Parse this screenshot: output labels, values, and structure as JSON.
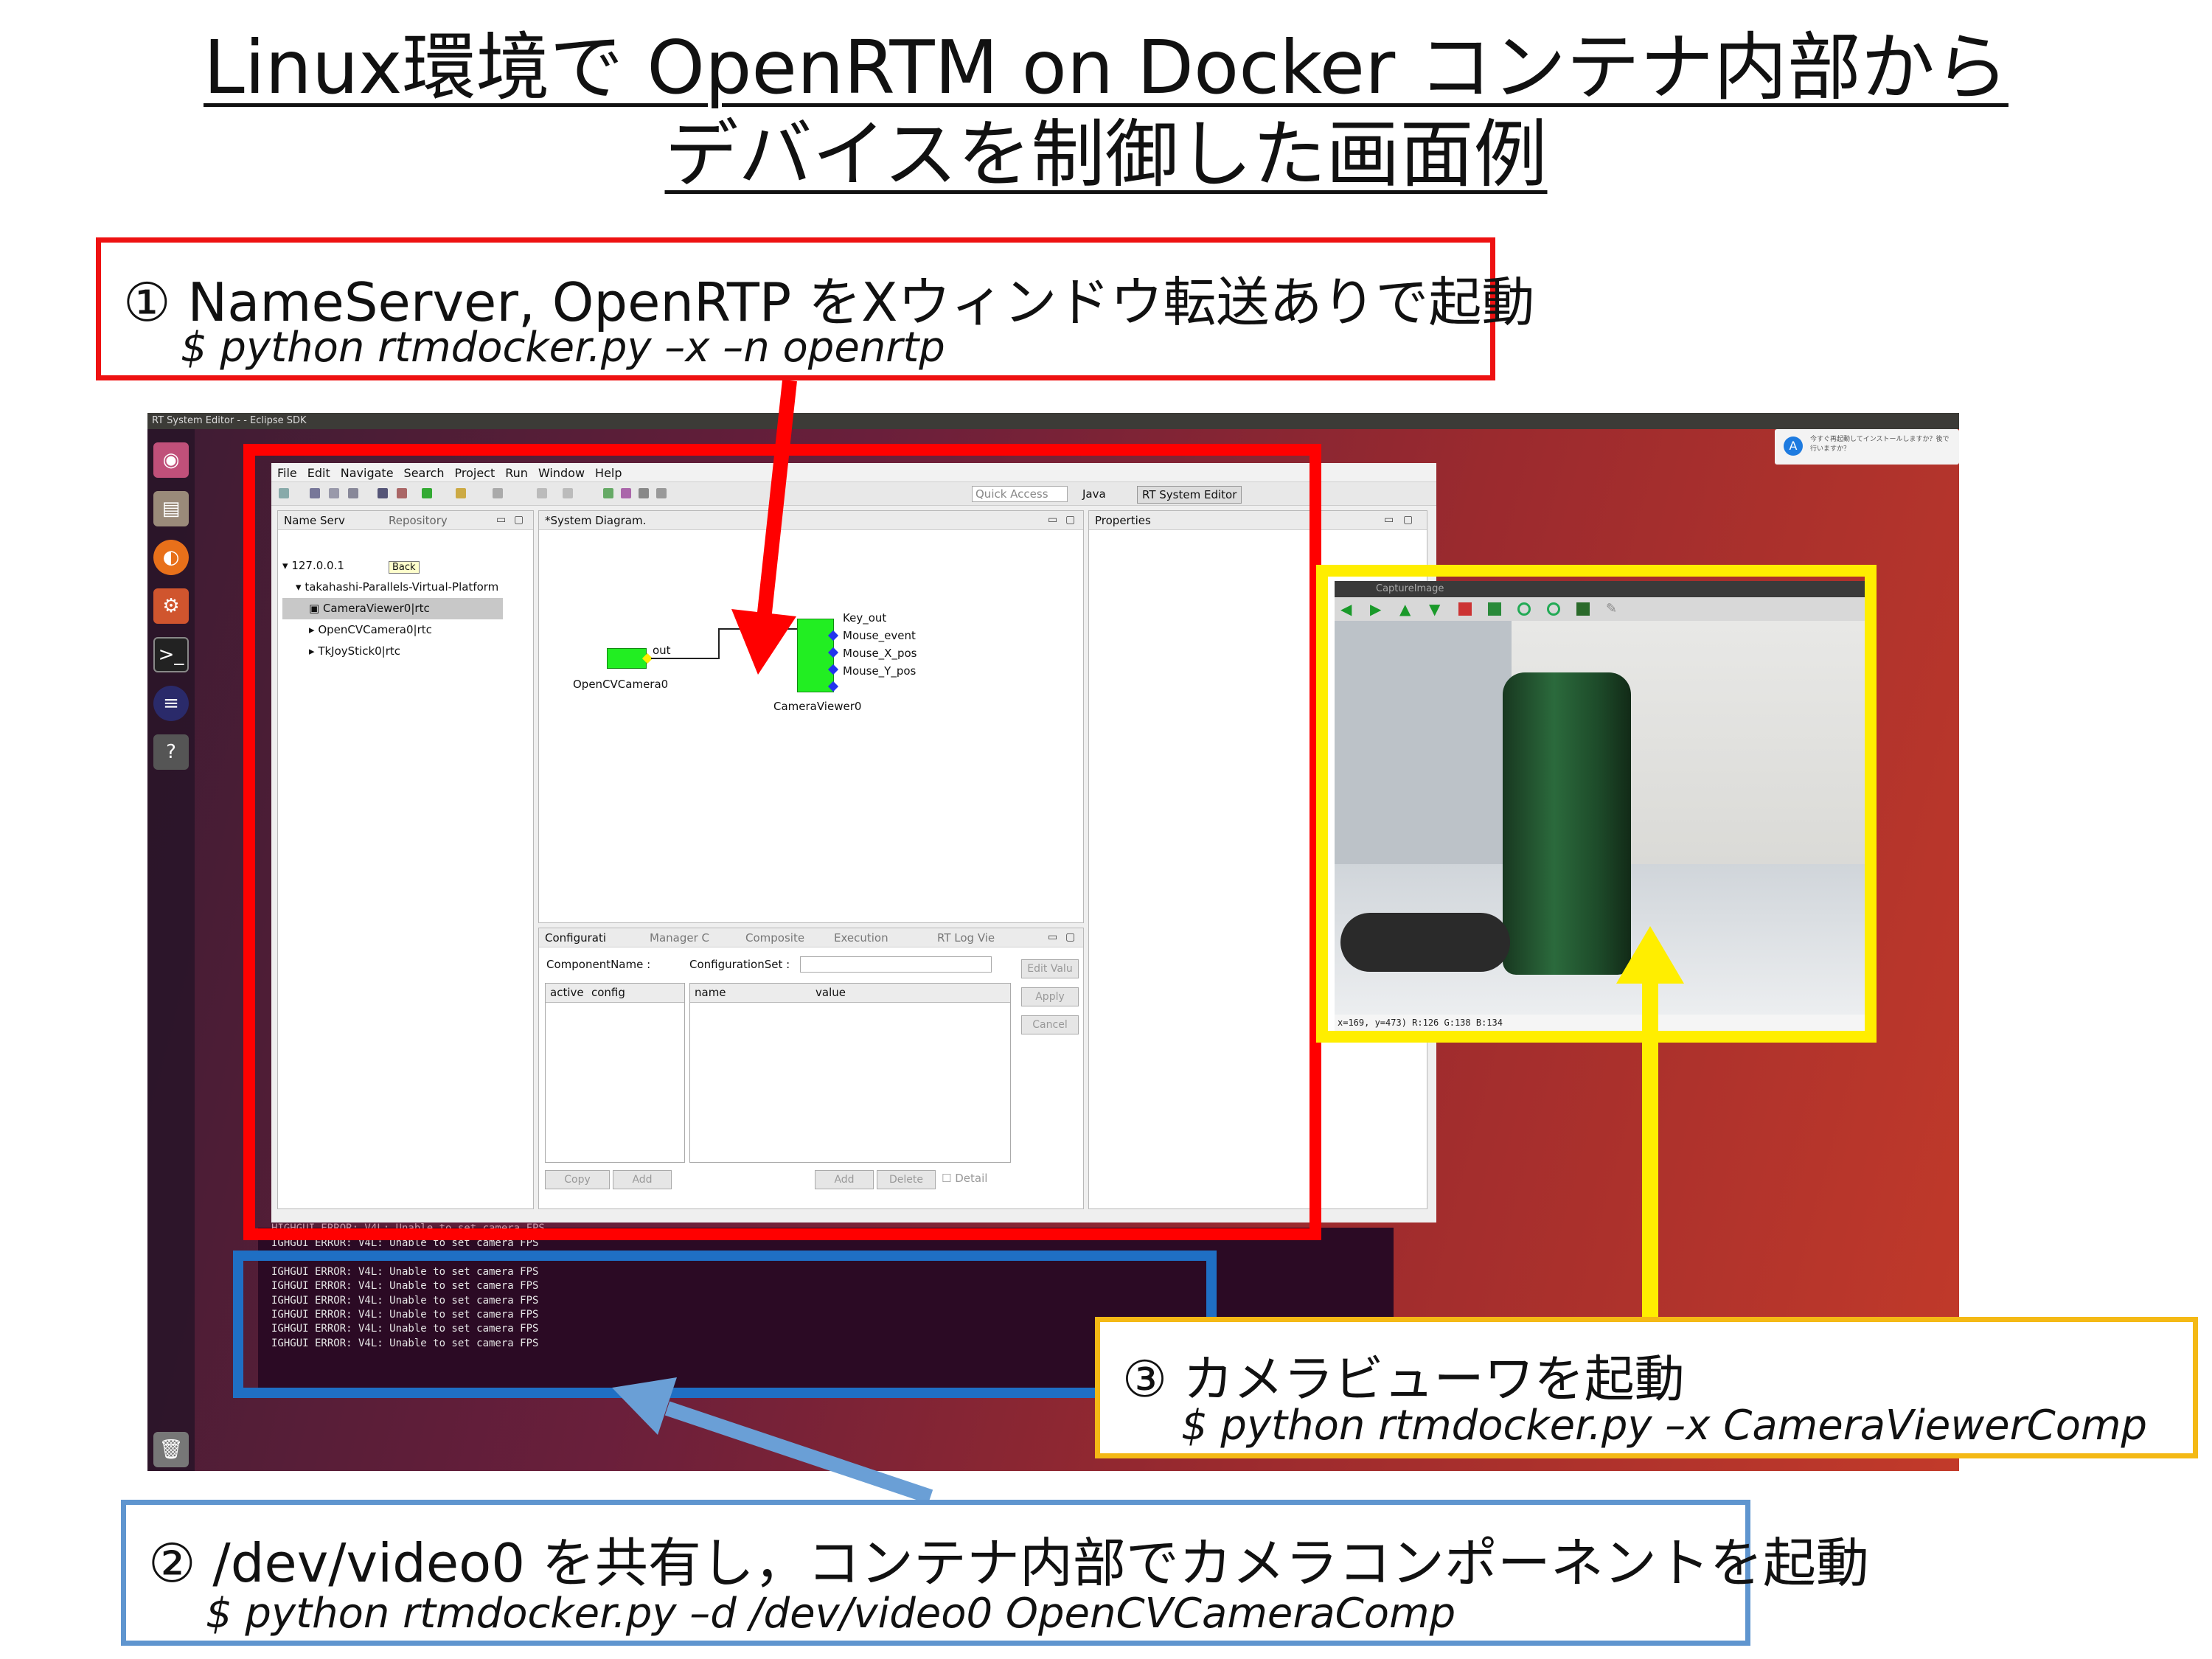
{
  "title": {
    "line1": "Linux環境で OpenRTM on Docker コンテナ内部から",
    "line2": "デバイスを制御した画面例"
  },
  "callouts": {
    "c1": {
      "heading": "① NameServer, OpenRTP をXウィンドウ転送ありで起動",
      "command": "$ python rtmdocker.py –x –n openrtp"
    },
    "c2": {
      "heading": "② /dev/video0 を共有し，コンテナ内部でカメラコンポーネントを起動",
      "command": "$ python rtmdocker.py –d /dev/video0 OpenCVCameraComp"
    },
    "c3": {
      "heading": "③ カメラビューワを起動",
      "command": "$ python rtmdocker.py –x CameraViewerComp"
    }
  },
  "desktop": {
    "os_title": "RT System Editor - - Eclipse SDK",
    "notify_text": "今すぐ再起動してインストールしますか？後で行いますか？"
  },
  "eclipse": {
    "menu": [
      "File",
      "Edit",
      "Navigate",
      "Search",
      "Project",
      "Run",
      "Window",
      "Help"
    ],
    "quick_access": "Quick Access",
    "perspective_java": "Java",
    "perspective_rt": "RT System Editor",
    "nameserver": {
      "tab1": "Name Serv",
      "tab2": "Repository",
      "host": "127.0.0.1",
      "back_tooltip": "Back",
      "node": "takahashi-Parallels-Virtual-Platform",
      "items": [
        "CameraViewer0|rtc",
        "OpenCVCamera0|rtc",
        "TkJoyStick0|rtc"
      ]
    },
    "diagram": {
      "tab": "*System Diagram.",
      "camera_name": "OpenCVCamera0",
      "camera_port": "out",
      "viewer_name": "CameraViewer0",
      "viewer_ports": [
        "Key_out",
        "Mouse_event",
        "Mouse_X_pos",
        "Mouse_Y_pos"
      ]
    },
    "properties_tab": "Properties",
    "config": {
      "tabs": [
        "Configurati",
        "Manager C",
        "Composite",
        "Execution",
        "RT Log Vie"
      ],
      "component_label": "ComponentName :",
      "configset_label": "ConfigurationSet :",
      "col_active": "active",
      "col_config": "config",
      "col_name": "name",
      "col_value": "value",
      "btn_edit": "Edit Valu",
      "btn_apply": "Apply",
      "btn_cancel": "Cancel",
      "btn_copy": "Copy",
      "btn_add": "Add",
      "btn_add2": "Add",
      "btn_delete": "Delete",
      "detail": "Detail"
    }
  },
  "terminal": {
    "partial_line": "HIGHGUI ERROR: V4L: Unable to set camera FPS",
    "lines": [
      "IGHGUI ERROR: V4L: Unable to set camera FPS",
      "IGHGUI ERROR: V4L: Unable to set camera FPS",
      "IGHGUI ERROR: V4L: Unable to set camera FPS",
      "IGHGUI ERROR: V4L: Unable to set camera FPS",
      "IGHGUI ERROR: V4L: Unable to set camera FPS",
      "IGHGUI ERROR: V4L: Unable to set camera FPS",
      "IGHGUI ERROR: V4L: Unable to set camera FPS",
      "IGHGUI ERROR: V4L: Unable to set camera FPS"
    ]
  },
  "camera_viewer": {
    "title": "CaptureImage",
    "status": "x=169, y=473)  R:126 G:138 B:134"
  },
  "colors": {
    "red": "#ff0000",
    "blue": "#1f6fc4",
    "yellow": "#ffee00",
    "callout_blue": "#5f95cf",
    "callout_yellow": "#f4b915",
    "rtc_green": "#22ee22"
  }
}
